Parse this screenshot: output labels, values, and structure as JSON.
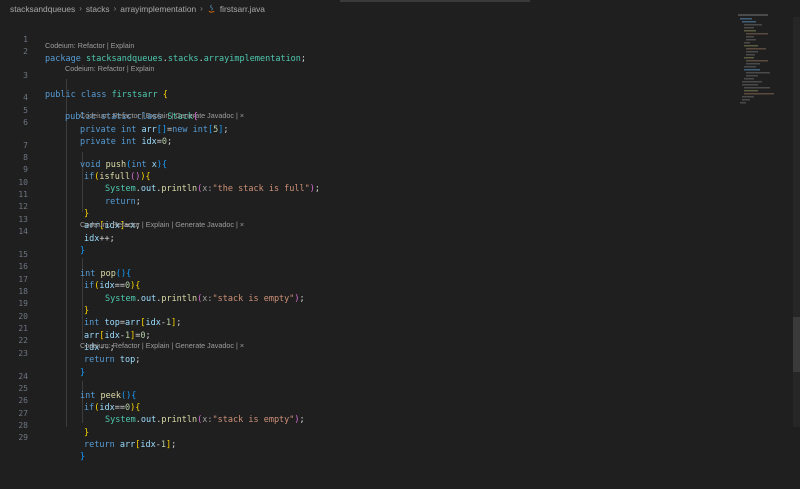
{
  "breadcrumb": {
    "items": [
      "stacksandqueues",
      "stacks",
      "arrayimplementation",
      "firstsarr.java"
    ],
    "separator": ">"
  },
  "codelens": {
    "refactor_explain": "Codeium: Refactor | Explain",
    "with_javadoc": "Codeium: Refactor | Explain | Generate Javadoc | ×"
  },
  "lines": [
    {
      "n": "1",
      "text": "package stacksandqueues.stacks.arrayimplementation;"
    },
    {
      "n": "2",
      "text": ""
    },
    {
      "n": "3",
      "text": "public class firstsarr {"
    },
    {
      "n": "4",
      "text": "  public static class Stack{"
    },
    {
      "n": "5",
      "text": "    private int arr[]=new int[5];"
    },
    {
      "n": "6",
      "text": "    private int idx=0;"
    },
    {
      "n": "7",
      "text": "    void push(int x){"
    },
    {
      "n": "8",
      "text": "     if(isfull()){"
    },
    {
      "n": "9",
      "text": "         System.out.println(x:\"the stack is full\");"
    },
    {
      "n": "10",
      "text": "         return;"
    },
    {
      "n": "11",
      "text": "     }"
    },
    {
      "n": "12",
      "text": "     arr[idx]=x;"
    },
    {
      "n": "13",
      "text": "     idx++;"
    },
    {
      "n": "14",
      "text": "    }"
    },
    {
      "n": "15",
      "text": "    int pop(){"
    },
    {
      "n": "16",
      "text": "     if(idx==0){"
    },
    {
      "n": "17",
      "text": "         System.out.println(x:\"stack is empty\");"
    },
    {
      "n": "18",
      "text": "     }"
    },
    {
      "n": "19",
      "text": "     int top=arr[idx-1];"
    },
    {
      "n": "20",
      "text": "     arr[idx-1]=0;"
    },
    {
      "n": "21",
      "text": "     idx--;"
    },
    {
      "n": "22",
      "text": "     return top;"
    },
    {
      "n": "23",
      "text": "    }"
    },
    {
      "n": "24",
      "text": "    int peek(){"
    },
    {
      "n": "25",
      "text": "     if(idx==0){"
    },
    {
      "n": "26",
      "text": "         System.out.println(x:\"stack is empty\");"
    },
    {
      "n": "27",
      "text": "     }"
    },
    {
      "n": "28",
      "text": "     return arr[idx-1];"
    },
    {
      "n": "29",
      "text": "    }"
    }
  ],
  "colors": {
    "background": "#1f1f1f",
    "keyword": "#569cd6",
    "function": "#dcdcaa",
    "class": "#4ec9b0",
    "variable": "#9cdcfe",
    "number": "#b5cea8",
    "string": "#ce9178"
  }
}
